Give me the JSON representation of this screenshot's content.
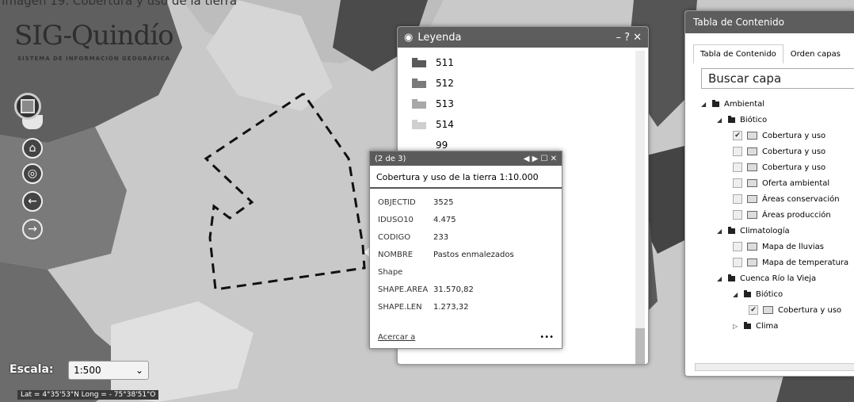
{
  "caption": "Imagen 19. Cobertura y uso de la tierra",
  "logo": {
    "title": "SIG-Quindío",
    "subtitle": "SISTEMA DE INFORMACIÓN GEOGRÁFICA"
  },
  "tools": [
    {
      "name": "home-icon",
      "glyph": "⌂"
    },
    {
      "name": "locate-icon",
      "glyph": "◎"
    },
    {
      "name": "back-arrow-icon",
      "glyph": "←"
    },
    {
      "name": "forward-arrow-icon",
      "glyph": "→"
    }
  ],
  "scale": {
    "label": "Escala:",
    "value": "1:500"
  },
  "coords": "Lat = 4°35'53\"N Long = - 75°38'51\"O",
  "legend": {
    "title": "Leyenda",
    "controls": "– ? ✕",
    "items": [
      {
        "label": "511",
        "color": "#5a5a5a"
      },
      {
        "label": "512",
        "color": "#7a7a7a"
      },
      {
        "label": "513",
        "color": "#a8a8a8"
      },
      {
        "label": "514",
        "color": "#cfcfcf"
      },
      {
        "label": "99",
        "color": "#ffffff"
      }
    ]
  },
  "popup": {
    "counter": "(2 de 3)",
    "controls": "◀ ▶ ☐ ✕",
    "title": "Cobertura y uso de la tierra 1:10.000",
    "attributes": [
      {
        "key": "OBJECTID",
        "value": "3525"
      },
      {
        "key": "IDUSO10",
        "value": "4.475"
      },
      {
        "key": "CODIGO",
        "value": "233"
      },
      {
        "key": "NOMBRE",
        "value": "Pastos enmalezados"
      },
      {
        "key": "Shape",
        "value": ""
      },
      {
        "key": "SHAPE.AREA",
        "value": "31.570,82"
      },
      {
        "key": "SHAPE.LEN",
        "value": "1.273,32"
      }
    ],
    "zoom_link": "Acercar a",
    "more": "•••"
  },
  "toc": {
    "title": "Tabla de Contenido",
    "tabs": [
      "Tabla de Contenido",
      "Orden capas"
    ],
    "search_placeholder": "Buscar capa",
    "tree": [
      {
        "type": "group",
        "arrow": "◢",
        "label": "Ambiental"
      },
      {
        "type": "group",
        "arrow": "◢",
        "label": "Biótico"
      },
      {
        "type": "layer",
        "checked": true,
        "label": "Cobertura y uso"
      },
      {
        "type": "layer",
        "checked": false,
        "label": "Cobertura y uso"
      },
      {
        "type": "layer",
        "checked": false,
        "label": "Cobertura y uso"
      },
      {
        "type": "layer",
        "checked": false,
        "label": "Oferta ambiental"
      },
      {
        "type": "layer",
        "checked": false,
        "label": "Áreas conservación"
      },
      {
        "type": "layer",
        "checked": false,
        "label": "Áreas producción"
      },
      {
        "type": "group",
        "arrow": "◢",
        "label": "Climatología"
      },
      {
        "type": "layer",
        "checked": false,
        "label": "Mapa de lluvias"
      },
      {
        "type": "layer",
        "checked": false,
        "label": "Mapa de temperatura"
      },
      {
        "type": "group",
        "arrow": "◢",
        "label": "Cuenca Río la Vieja"
      },
      {
        "type": "group",
        "arrow": "◢",
        "label": "Biótico"
      },
      {
        "type": "layer",
        "checked": true,
        "label": "Cobertura y uso"
      },
      {
        "type": "group",
        "arrow": "▷",
        "label": "Clima"
      }
    ]
  }
}
